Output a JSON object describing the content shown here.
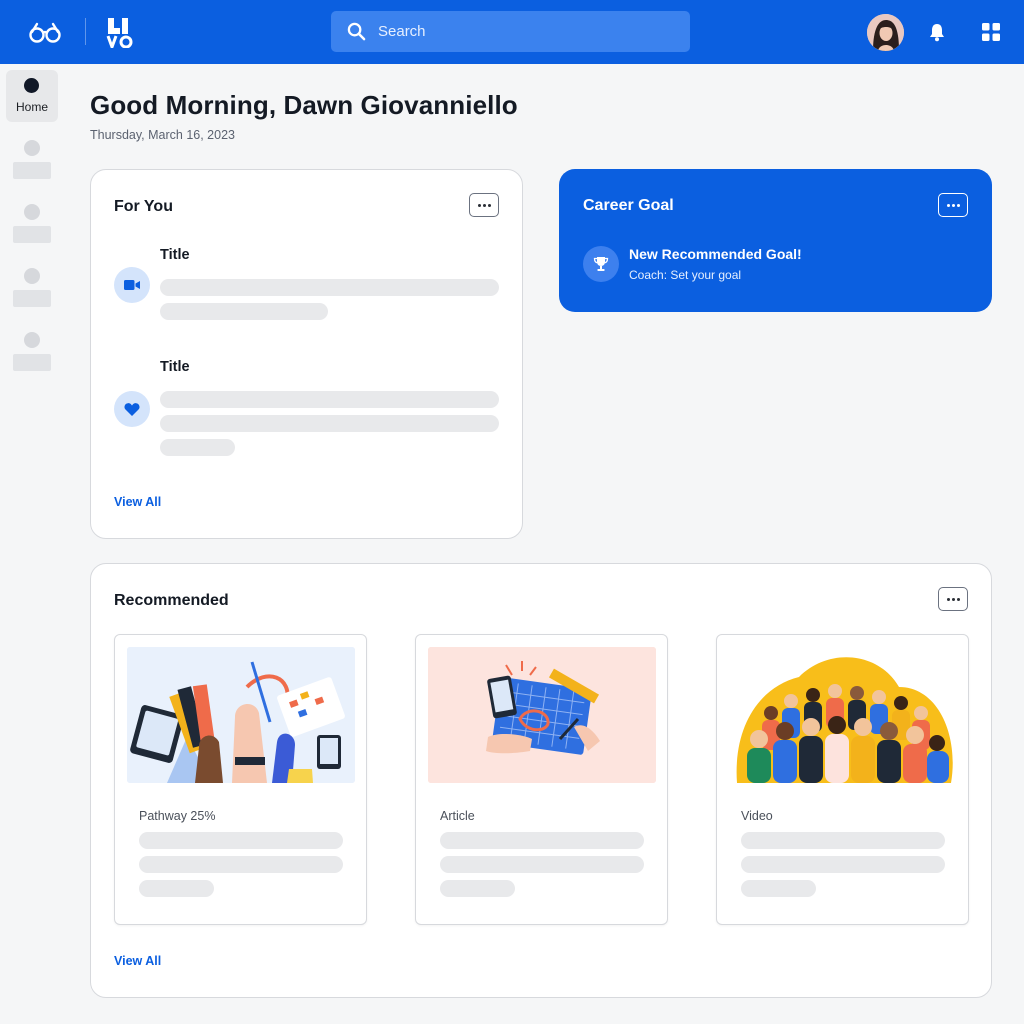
{
  "header": {
    "search_placeholder": "Search",
    "icons": [
      "glasses-logo-icon",
      "live-logo-icon",
      "search-icon",
      "user-avatar",
      "bell-icon",
      "apps-grid-icon"
    ],
    "brand_color": "#0b5fe0"
  },
  "sidenav": {
    "home_label": "Home"
  },
  "greeting": {
    "title": "Good Morning, Dawn Giovanniello",
    "date": "Thursday, March 16, 2023"
  },
  "for_you": {
    "title": "For You",
    "items": [
      {
        "title": "Title",
        "icon": "video-camera-icon"
      },
      {
        "title": "Title",
        "icon": "heart-icon"
      }
    ],
    "view_all": "View All"
  },
  "career_goal": {
    "title": "Career Goal",
    "goal_title": "New Recommended Goal!",
    "goal_subtitle": "Coach: Set your goal",
    "icon": "trophy-icon"
  },
  "recommended": {
    "title": "Recommended",
    "items": [
      {
        "type_label": "Pathway 25%",
        "progress_percent": 25
      },
      {
        "type_label": "Article"
      },
      {
        "type_label": "Video"
      }
    ],
    "view_all": "View All"
  }
}
